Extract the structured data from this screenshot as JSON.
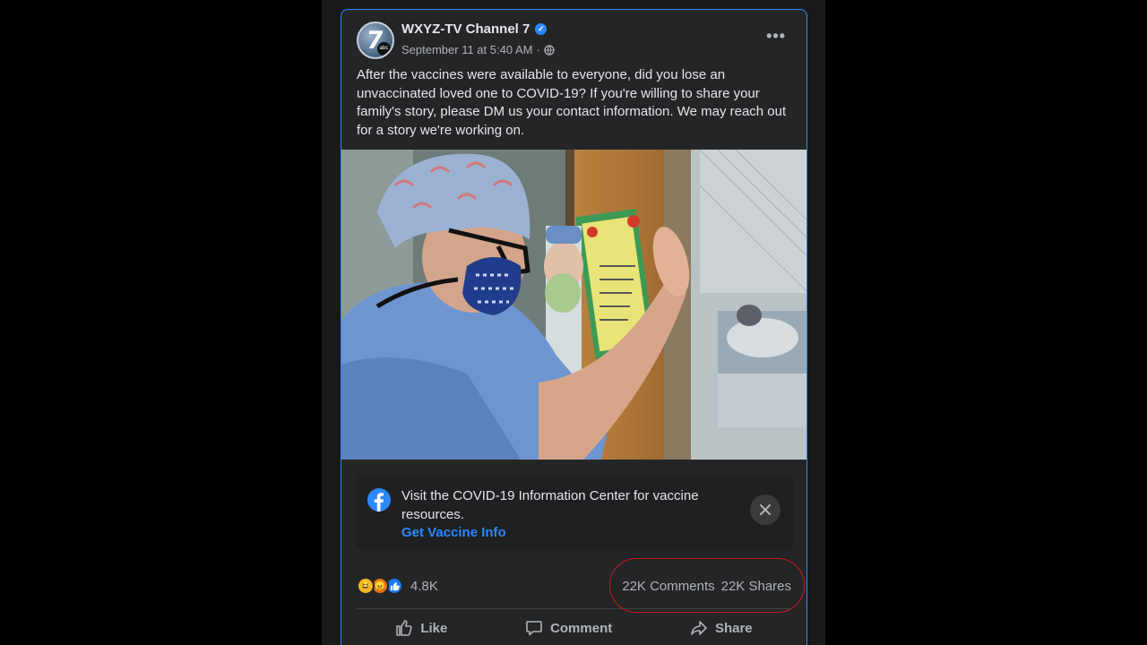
{
  "post": {
    "page_name": "WXYZ-TV Channel 7",
    "avatar_text": "7",
    "avatar_badge": "abc",
    "timestamp": "September 11 at 5:40 AM",
    "separator": "·",
    "privacy_icon": "globe-icon",
    "more_label": "•••",
    "text": "After the vaccines were available to everyone, did you lose an unvaccinated loved one to COVID-19? If you're willing to share your family's story, please DM us your contact information. We may reach out for a story we're working on."
  },
  "info_center": {
    "icon": "facebook-logo-icon",
    "text": "Visit the COVID-19 Information Center for vaccine resources.",
    "link": "Get Vaccine Info",
    "close_icon": "close-icon"
  },
  "stats": {
    "reactions": [
      "haha",
      "angry",
      "like"
    ],
    "reaction_count": "4.8K",
    "comments": "22K Comments",
    "shares": "22K Shares"
  },
  "actions": {
    "like": "Like",
    "comment": "Comment",
    "share": "Share"
  },
  "colors": {
    "accent": "#2d88ff",
    "card_bg": "#242526",
    "annotation": "#c9191f"
  }
}
